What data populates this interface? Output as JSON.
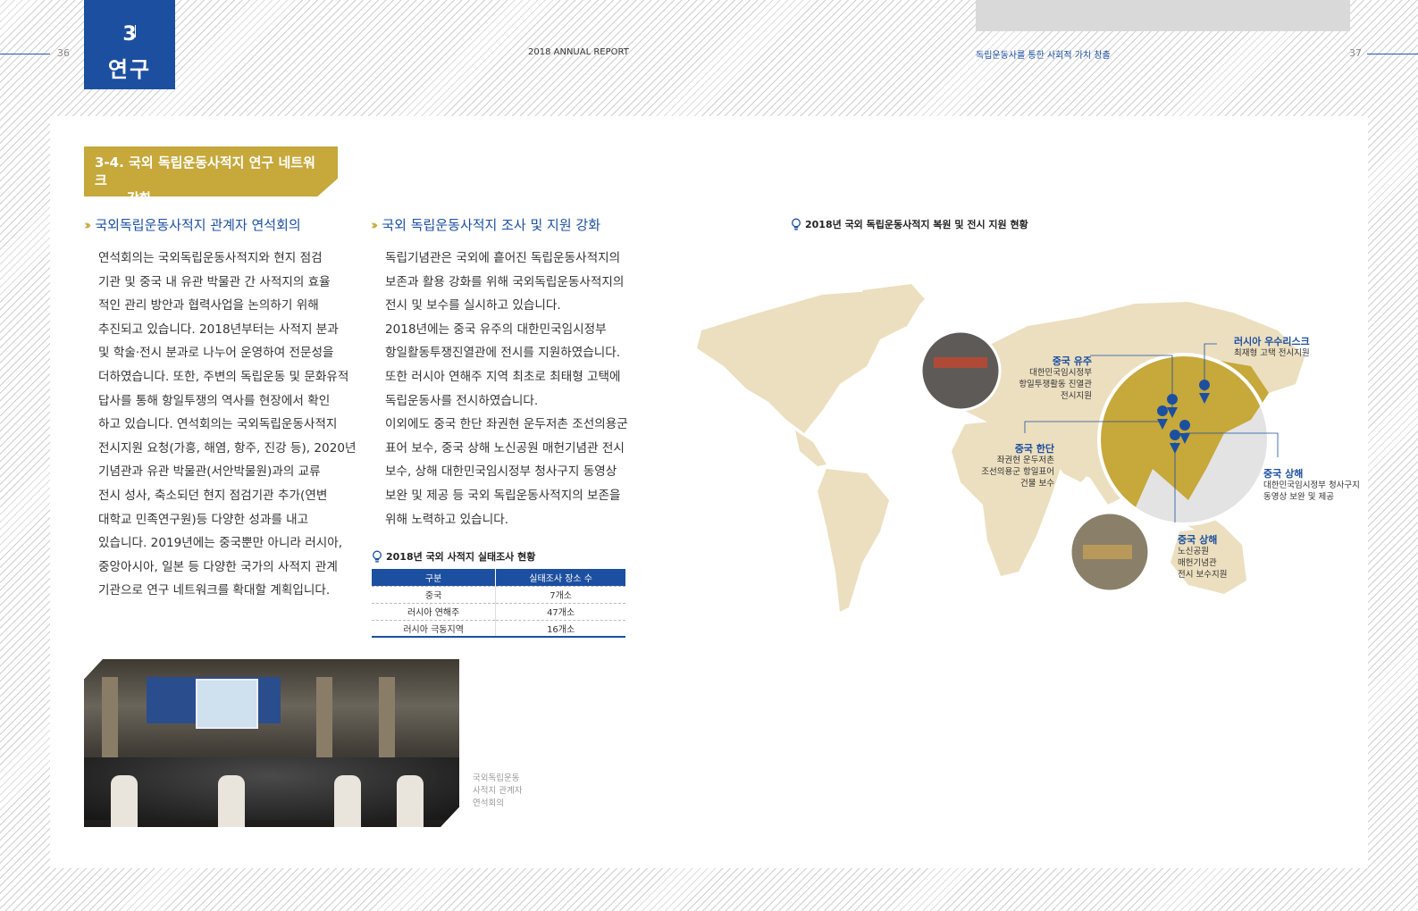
{
  "header": {
    "left_page_number": "36",
    "right_page_number": "37",
    "report_title": "2018 ANNUAL REPORT",
    "right_header": "독립운동사를 통한 사회적 가치 창출",
    "chapter_number": "3",
    "chapter_name": "연구"
  },
  "section": {
    "title_line1": "3-4. 국외 독립운동사적지 연구 네트워크",
    "title_line2": "강화"
  },
  "left_column": {
    "subtitle": "국외독립운동사적지 관계자 연석회의",
    "lines": [
      "연석회의는 국외독립운동사적지와 현지 점검",
      "기관 및 중국 내 유관 박물관 간 사적지의 효율",
      "적인 관리 방안과 협력사업을 논의하기 위해",
      "추진되고 있습니다. 2018년부터는 사적지 분과",
      "및 학술·전시 분과로 나누어 운영하여 전문성을",
      "더하였습니다. 또한, 주변의 독립운동 및 문화유적",
      "답사를 통해 항일투쟁의 역사를 현장에서 확인",
      "하고 있습니다. 연석회의는 국외독립운동사적지",
      "전시지원 요청(가흥, 해염, 항주, 진강 등), 2020년",
      "기념관과 유관 박물관(서안박물원)과의 교류",
      "전시 성사, 축소되던 현지 점검기관 추가(연변",
      "대학교 민족연구원)등 다양한 성과를 내고",
      "있습니다. 2019년에는 중국뿐만 아니라 러시아,",
      "중앙아시아, 일본 등 다양한 국가의 사적지 관계",
      "기관으로 연구 네트워크를 확대할 계획입니다."
    ]
  },
  "middle_column": {
    "subtitle": "국외 독립운동사적지 조사 및 지원 강화",
    "lines": [
      "독립기념관은 국외에 흩어진 독립운동사적지의",
      "보존과 활용 강화를 위해 국외독립운동사적지의",
      "전시 및 보수를 실시하고 있습니다.",
      "2018년에는 중국 유주의 대한민국임시정부",
      "항일활동투쟁진열관에 전시를 지원하였습니다.",
      "또한 러시아 연해주 지역 최초로 최태형 고택에",
      "독립운동사를 전시하였습니다.",
      "이외에도 중국 한단 좌권현 운두저촌 조선의용군",
      "표어 보수, 중국 상해 노신공원 매헌기념관 전시",
      "보수, 상해 대한민국임시정부 청사구지 동영상",
      "보완 및 제공 등 국외 독립운동사적지의 보존을",
      "위해 노력하고 있습니다."
    ],
    "table_title": "2018년 국외 사적지 실태조사 현황",
    "table_headers": [
      "구분",
      "실태조사 장소 수"
    ],
    "table_rows": [
      [
        "중국",
        "7개소"
      ],
      [
        "러시아 연해주",
        "47개소"
      ],
      [
        "러시아 극동지역",
        "16개소"
      ]
    ]
  },
  "photo_caption": [
    "국외독립운동",
    "사적지 관계자",
    "연석회의"
  ],
  "map": {
    "title": "2018년 국외 독립운동사적지 복원 및 전시 지원 현황",
    "land_color": "#ecdfbf",
    "highlight_color": "#c6a83b",
    "pin_color": "#1c4fa0",
    "locations": [
      {
        "place": "중국 유주",
        "desc": [
          "대한민국임시정부",
          "항일투쟁활동 진열관",
          "전시지원"
        ]
      },
      {
        "place": "러시아 우수리스크",
        "desc": [
          "최재형 고택 전시지원"
        ]
      },
      {
        "place": "중국 한단",
        "desc": [
          "좌권현 운두저촌",
          "조선의용군 항일표어",
          "건물 보수"
        ]
      },
      {
        "place": "중국 상해",
        "desc": [
          "대한민국임시정부 청사구지",
          "동영상 보완 및 제공"
        ]
      },
      {
        "place": "중국 상해",
        "desc": [
          "노신공원",
          "매헌기념관",
          "전시 보수지원"
        ]
      }
    ]
  }
}
